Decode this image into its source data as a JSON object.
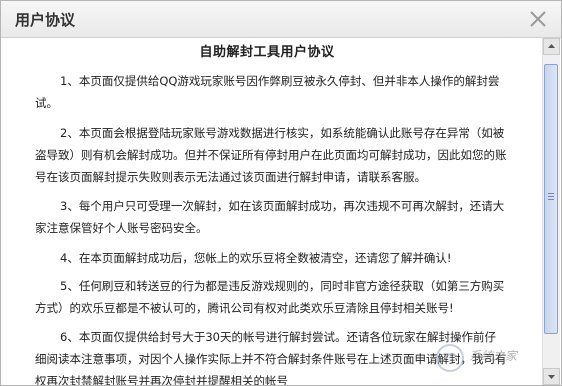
{
  "dialog": {
    "title": "用户协议"
  },
  "document": {
    "heading": "自助解封工具用户协议",
    "paragraphs": [
      "1、本页面仅提供给QQ游戏玩家账号因作弊刷豆被永久停封、但并非本人操作的解封尝试。",
      "2、本页面会根据登陆玩家账号游戏数据进行核实，如系统能确认此账号存在异常（如被盗导致）则有机会解封成功。但并不保证所有停封用户在此页面均可解封成功，因此如您的账号在该页面解封提示失败则表示无法通过该页面进行解封申请，请联系客服。",
      "3、每个用户只可受理一次解封，如在该页面解封成功，再次违规不可再次解封，还请大家注意保管好个人账号密码安全。",
      "4、在本页面解封成功后，您帐上的欢乐豆将全数被清空，还请您了解并确认!",
      "5、任何刷豆和转送豆的行为都是违反游戏规则的，同时非官方途径获取（如第三方购买方式）的欢乐豆都是不被认可的，腾讯公司有权对此类欢乐豆清除且停封相关账号!",
      "6、本页面仅提供给封号大于30天的帐号进行解封尝试。还请各位玩家在解封操作前仔细阅读本注意事项，对因个人操作实际上并不符合解封条件账号在上述页面申请解封，我司有权再次封禁解封账号并再次停封并提醒相关的帐号"
    ]
  },
  "watermark": {
    "text": "系统之家"
  }
}
